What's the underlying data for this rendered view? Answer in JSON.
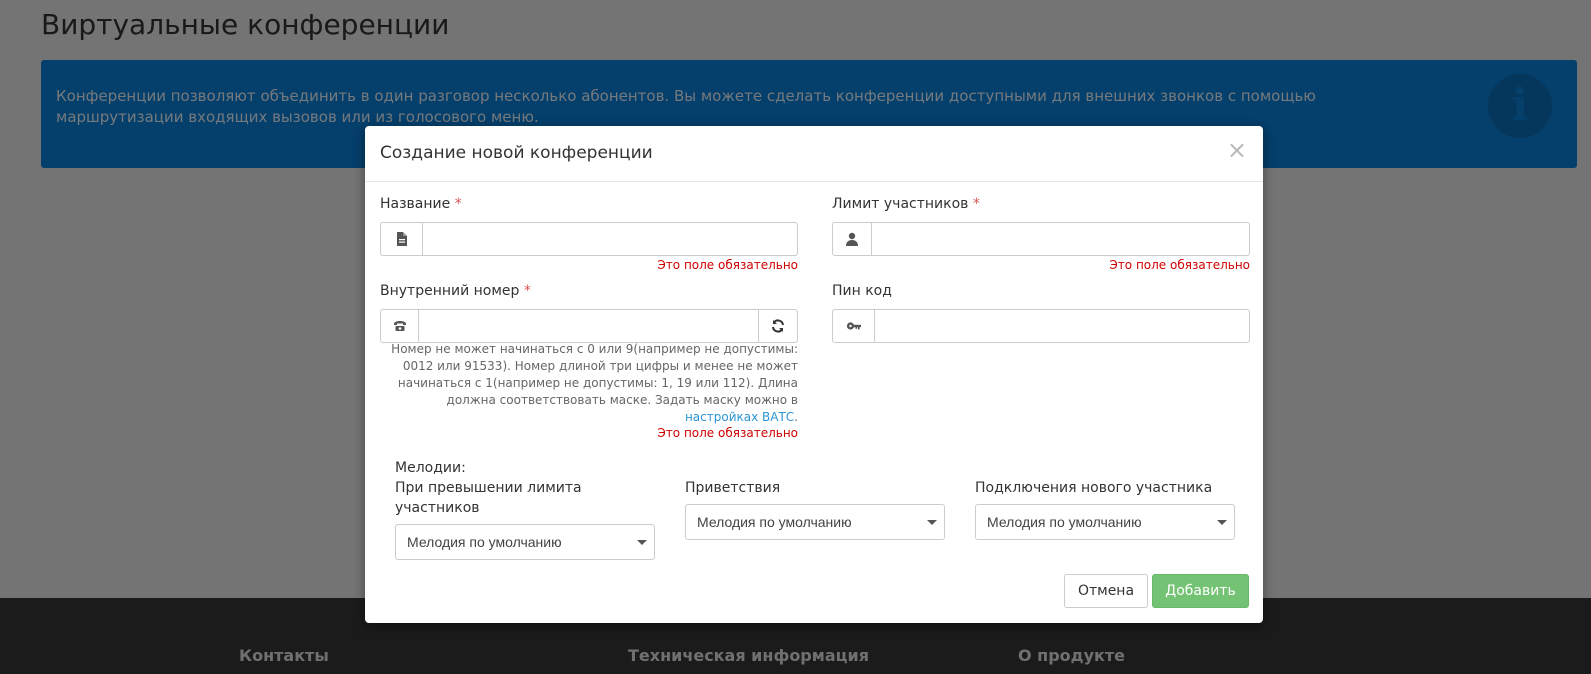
{
  "page": {
    "title": "Виртуальные конференции",
    "info_text": "Конференции позволяют объединить в один разговор несколько абонентов. Вы можете сделать конференции доступными для внешних звонков с помощью маршрутизации входящих вызовов или из голосового меню.",
    "info_icon": "i"
  },
  "footer": {
    "col1": "Контакты",
    "col2": "Техническая информация",
    "col3": "О продукте"
  },
  "modal": {
    "title": "Создание новой конференции",
    "close_label": "×",
    "required_mark": "*",
    "name_label": "Название",
    "limit_label": "Лимит участников",
    "internal_number_label": "Внутренний номер",
    "pin_label": "Пин код",
    "error_required": "Это поле обязательно",
    "number_help": "Номер не может начинаться с 0 или 9(например не допустимы: 0012 или 91533). Номер длиной три цифры и менее не может начинаться с 1(например не допустимы: 1, 19 или 112). Длина должна соответствовать маске. Задать маску можно в",
    "number_help_link": "настройках ВАТС",
    "number_help_end": ".",
    "melodies_heading": "Мелодии:",
    "melody_limit_label": "При превышении лимита участников",
    "melody_greeting_label": "Приветствия",
    "melody_join_label": "Подключения нового участника",
    "melody_default": "Мелодия по умолчанию",
    "cancel_label": "Отмена",
    "add_label": "Добавить"
  },
  "icons": {
    "name_addon": "file-icon",
    "limit_addon": "user-icon",
    "number_addon": "phone-icon",
    "refresh": "refresh-icon",
    "pin_addon": "key-icon"
  }
}
